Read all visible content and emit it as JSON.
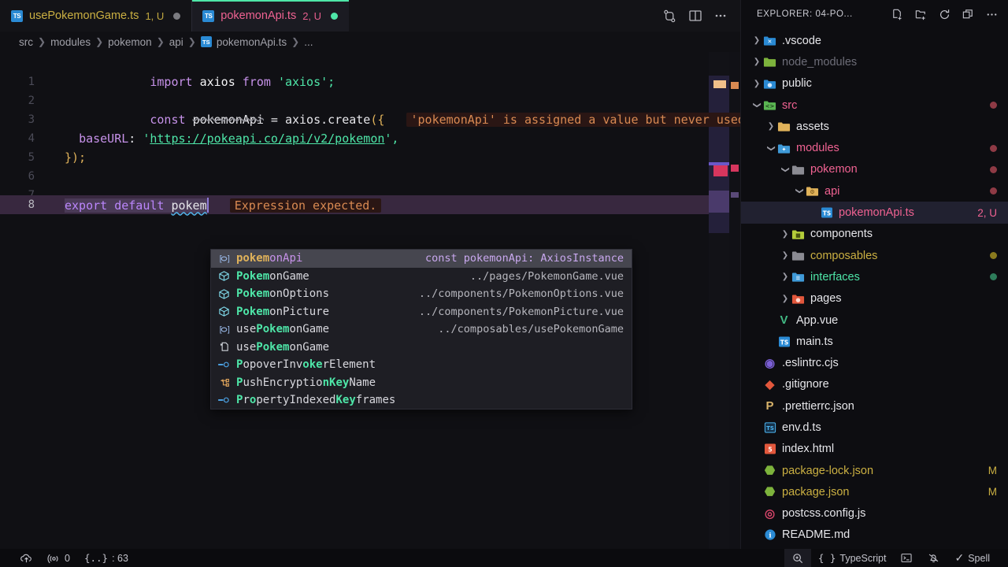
{
  "tabs": [
    {
      "icon": "typescript-icon",
      "icon_label": "TS",
      "label": "usePokemonGame.ts",
      "badge": "1, U",
      "dot": "grey",
      "active": false
    },
    {
      "icon": "typescript-icon",
      "icon_label": "TS",
      "label": "pokemonApi.ts",
      "badge": "2, U",
      "dot": "green",
      "active": true
    }
  ],
  "tabbar_actions": [
    {
      "name": "split-diff-icon"
    },
    {
      "name": "split-editor-icon"
    },
    {
      "name": "more-actions-icon"
    }
  ],
  "breadcrumb": {
    "items": [
      "src",
      "modules",
      "pokemon",
      "api"
    ],
    "file": "pokemonApi.ts",
    "file_icon_label": "TS",
    "tail": "..."
  },
  "editor": {
    "lines": [
      {
        "no": "1"
      },
      {
        "no": "2"
      },
      {
        "no": "3"
      },
      {
        "no": "4"
      },
      {
        "no": "5"
      },
      {
        "no": "6"
      },
      {
        "no": "7"
      },
      {
        "no": "8"
      }
    ],
    "line1": {
      "kw_import": "import",
      "name": "axios",
      "kw_from": "from",
      "module": "'axios';"
    },
    "line3": {
      "kw": "const",
      "ident": "pokemonApi",
      "eq": "=",
      "obj": "axios",
      "dot": ".",
      "method": "create",
      "open": "({",
      "error": "'pokemonApi' is assigned a value but never used."
    },
    "line4": {
      "prop": "baseURL",
      "colon": ":",
      "q1": "'",
      "url": "https://pokeapi.co/api/v2/pokemon",
      "q2": "',"
    },
    "line5": {
      "close": "});"
    },
    "line8": {
      "kw_export": "export",
      "kw_default": "default",
      "typed": "pokem",
      "error": "Expression expected."
    }
  },
  "suggest": {
    "items": [
      {
        "icon": "variable-icon",
        "prefix": "pokem",
        "rest": "onApi",
        "detail": "const pokemonApi: AxiosInstance",
        "selected": true
      },
      {
        "icon": "module-icon",
        "prefix": "Pokem",
        "rest": "onGame",
        "detail": "../pages/PokemonGame.vue",
        "selected": false
      },
      {
        "icon": "module-icon",
        "prefix": "Pokem",
        "rest": "onOptions",
        "detail": "../components/PokemonOptions.vue",
        "selected": false
      },
      {
        "icon": "module-icon",
        "prefix": "Pokem",
        "rest": "onPicture",
        "detail": "../components/PokemonPicture.vue",
        "selected": false
      },
      {
        "icon": "variable-icon",
        "pre": "use",
        "prefix": "Pokem",
        "rest": "onGame",
        "detail": "../composables/usePokemonGame",
        "selected": false
      },
      {
        "icon": "file-import-icon",
        "pre": "use",
        "prefix": "Pokem",
        "rest": "onGame",
        "detail": "",
        "selected": false
      },
      {
        "icon": "interface-icon",
        "pre": "P",
        "prefix": "",
        "rest": "",
        "full_parts": [
          "P",
          "opoverInv",
          "oke",
          "rElement"
        ],
        "detail": "",
        "selected": false
      },
      {
        "icon": "enum-icon",
        "full_parts": [
          "P",
          "ushEncryptio",
          "nKey",
          "Name"
        ],
        "detail": "",
        "selected": false
      },
      {
        "icon": "interface-icon",
        "full_parts": [
          "P",
          "r",
          "o",
          "pertyIndexed"
        ],
        "detail": "",
        "selected": false
      }
    ],
    "labels": [
      "pokemonApi",
      "PokemonGame",
      "PokemonOptions",
      "PokemonPicture",
      "usePokemonGame",
      "usePokemonGame",
      "PopoverInvokerElement",
      "PushEncryptionKeyName",
      "PropertyIndexedKeyframes"
    ]
  },
  "sidebar": {
    "title": "EXPLORER: 04-PO...",
    "actions": [
      {
        "name": "new-file-icon"
      },
      {
        "name": "new-folder-icon"
      },
      {
        "name": "refresh-icon"
      },
      {
        "name": "collapse-all-icon"
      },
      {
        "name": "explorer-more-icon"
      }
    ],
    "items": [
      {
        "label": ".vscode",
        "indent": 0,
        "chev": "right",
        "icon": "vscode-folder-icon",
        "color": "#e6e6ea",
        "badge": "",
        "dot": ""
      },
      {
        "label": "node_modules",
        "indent": 0,
        "chev": "right",
        "icon": "node-folder-icon",
        "color": "#6d6d78",
        "badge": "",
        "dot": ""
      },
      {
        "label": "public",
        "indent": 0,
        "chev": "right",
        "icon": "public-folder-icon",
        "color": "#e6e6ea",
        "badge": "",
        "dot": ""
      },
      {
        "label": "src",
        "indent": 0,
        "chev": "down",
        "icon": "src-folder-icon",
        "color": "#f06292",
        "badge": "",
        "dot": "#8e3a45"
      },
      {
        "label": "assets",
        "indent": 1,
        "chev": "right",
        "icon": "assets-folder-icon",
        "color": "#e6e6ea",
        "badge": "",
        "dot": ""
      },
      {
        "label": "modules",
        "indent": 1,
        "chev": "down",
        "icon": "modules-folder-icon",
        "color": "#f06292",
        "badge": "",
        "dot": "#8e3a45"
      },
      {
        "label": "pokemon",
        "indent": 2,
        "chev": "down",
        "icon": "plain-folder-open-icon",
        "color": "#f06292",
        "badge": "",
        "dot": "#8e3a45"
      },
      {
        "label": "api",
        "indent": 3,
        "chev": "down",
        "icon": "api-folder-icon",
        "color": "#f06292",
        "badge": "",
        "dot": "#8e3a45"
      },
      {
        "label": "pokemonApi.ts",
        "indent": 4,
        "chev": "none",
        "icon": "typescript-file-icon",
        "color": "#f06292",
        "badge": "2, U",
        "dot": "",
        "selected": true
      },
      {
        "label": "components",
        "indent": 2,
        "chev": "right",
        "icon": "components-folder-icon",
        "color": "#e6e6ea",
        "badge": "",
        "dot": ""
      },
      {
        "label": "composables",
        "indent": 2,
        "chev": "right",
        "icon": "plain-folder-icon",
        "color": "#cbb042",
        "badge": "",
        "dot": "#8a7a1e"
      },
      {
        "label": "interfaces",
        "indent": 2,
        "chev": "right",
        "icon": "interfaces-folder-icon",
        "color": "#4ee6a8",
        "badge": "",
        "dot": "#2e7d5b"
      },
      {
        "label": "pages",
        "indent": 2,
        "chev": "right",
        "icon": "pages-folder-icon",
        "color": "#e6e6ea",
        "badge": "",
        "dot": ""
      },
      {
        "label": "App.vue",
        "indent": 1,
        "chev": "none",
        "icon": "vue-file-icon",
        "color": "#e6e6ea",
        "badge": "",
        "dot": ""
      },
      {
        "label": "main.ts",
        "indent": 1,
        "chev": "none",
        "icon": "typescript-file-icon",
        "color": "#e6e6ea",
        "badge": "",
        "dot": ""
      },
      {
        "label": ".eslintrc.cjs",
        "indent": 0,
        "chev": "none",
        "icon": "eslint-file-icon",
        "color": "#e6e6ea",
        "badge": "",
        "dot": ""
      },
      {
        "label": ".gitignore",
        "indent": 0,
        "chev": "none",
        "icon": "git-file-icon",
        "color": "#e6e6ea",
        "badge": "",
        "dot": ""
      },
      {
        "label": ".prettierrc.json",
        "indent": 0,
        "chev": "none",
        "icon": "prettier-file-icon",
        "color": "#e6e6ea",
        "badge": "",
        "dot": ""
      },
      {
        "label": "env.d.ts",
        "indent": 0,
        "chev": "none",
        "icon": "typescript-def-icon",
        "color": "#e6e6ea",
        "badge": "",
        "dot": ""
      },
      {
        "label": "index.html",
        "indent": 0,
        "chev": "none",
        "icon": "html-file-icon",
        "color": "#e6e6ea",
        "badge": "",
        "dot": ""
      },
      {
        "label": "package-lock.json",
        "indent": 0,
        "chev": "none",
        "icon": "npm-file-icon",
        "color": "#cbb042",
        "badge": "M",
        "dot": ""
      },
      {
        "label": "package.json",
        "indent": 0,
        "chev": "none",
        "icon": "npm-file-icon",
        "color": "#cbb042",
        "badge": "M",
        "dot": ""
      },
      {
        "label": "postcss.config.js",
        "indent": 0,
        "chev": "none",
        "icon": "postcss-file-icon",
        "color": "#e6e6ea",
        "badge": "",
        "dot": ""
      },
      {
        "label": "README.md",
        "indent": 0,
        "chev": "none",
        "icon": "readme-file-icon",
        "color": "#e6e6ea",
        "badge": "",
        "dot": ""
      }
    ]
  },
  "statusbar": {
    "left": [
      {
        "name": "remote-cloud-icon",
        "text": ""
      },
      {
        "name": "radio-tower-icon",
        "text": "0"
      },
      {
        "name": "braces-icon",
        "text": ": 63"
      }
    ],
    "right": [
      {
        "name": "zoom-search-icon",
        "text": ""
      },
      {
        "name": "braces-lang-icon",
        "text": "TypeScript"
      },
      {
        "name": "terminal-icon",
        "text": ""
      },
      {
        "name": "bell-slash-icon",
        "text": ""
      },
      {
        "name": "spell-check-icon",
        "text": "Spell"
      }
    ],
    "errors_count": "0",
    "chars_count": "63",
    "language": "TypeScript",
    "spell_label": "Spell"
  }
}
